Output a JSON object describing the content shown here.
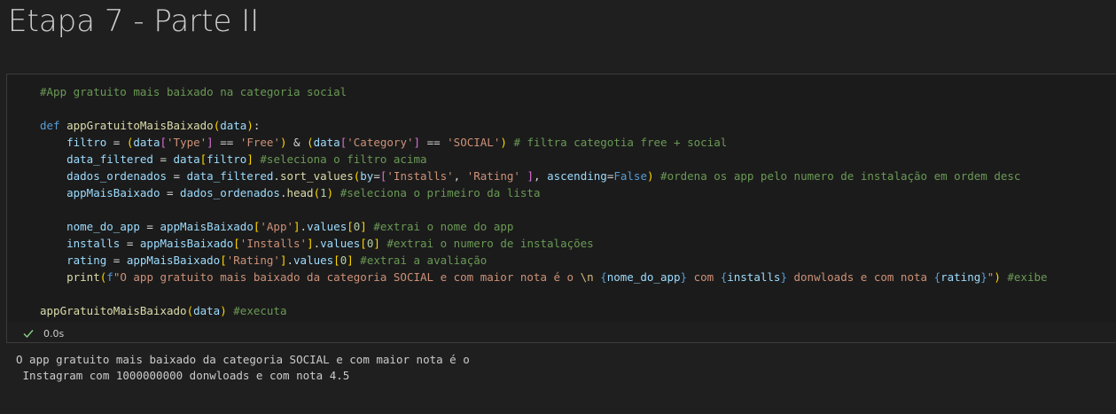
{
  "heading": "Etapa 7 - Parte II",
  "code_lines": [
    [
      [
        "t-comment",
        "#App gratuito mais baixado na categoria social"
      ]
    ],
    [],
    [
      [
        "t-keyword",
        "def "
      ],
      [
        "t-func",
        "appGratuitoMaisBaixado"
      ],
      [
        "t-bracket1",
        "("
      ],
      [
        "t-var",
        "data"
      ],
      [
        "t-bracket1",
        ")"
      ],
      [
        "t-plain",
        ":"
      ]
    ],
    [
      [
        "t-plain",
        "    "
      ],
      [
        "t-var",
        "filtro"
      ],
      [
        "t-plain",
        " = "
      ],
      [
        "t-bracket1",
        "("
      ],
      [
        "t-var",
        "data"
      ],
      [
        "t-bracket2",
        "["
      ],
      [
        "t-string",
        "'Type'"
      ],
      [
        "t-bracket2",
        "]"
      ],
      [
        "t-plain",
        " == "
      ],
      [
        "t-string",
        "'Free'"
      ],
      [
        "t-bracket1",
        ")"
      ],
      [
        "t-plain",
        " & "
      ],
      [
        "t-bracket1",
        "("
      ],
      [
        "t-var",
        "data"
      ],
      [
        "t-bracket2",
        "["
      ],
      [
        "t-string",
        "'Category'"
      ],
      [
        "t-bracket2",
        "]"
      ],
      [
        "t-plain",
        " == "
      ],
      [
        "t-string",
        "'SOCIAL'"
      ],
      [
        "t-bracket1",
        ")"
      ],
      [
        "t-plain",
        " "
      ],
      [
        "t-comment",
        "# filtra categotia free + social"
      ]
    ],
    [
      [
        "t-plain",
        "    "
      ],
      [
        "t-var",
        "data_filtered"
      ],
      [
        "t-plain",
        " = "
      ],
      [
        "t-var",
        "data"
      ],
      [
        "t-bracket1",
        "["
      ],
      [
        "t-var",
        "filtro"
      ],
      [
        "t-bracket1",
        "]"
      ],
      [
        "t-plain",
        " "
      ],
      [
        "t-comment",
        "#seleciona o filtro acima"
      ]
    ],
    [
      [
        "t-plain",
        "    "
      ],
      [
        "t-var",
        "dados_ordenados"
      ],
      [
        "t-plain",
        " = "
      ],
      [
        "t-var",
        "data_filtered"
      ],
      [
        "t-plain",
        "."
      ],
      [
        "t-func",
        "sort_values"
      ],
      [
        "t-bracket1",
        "("
      ],
      [
        "t-var",
        "by"
      ],
      [
        "t-plain",
        "="
      ],
      [
        "t-bracket2",
        "["
      ],
      [
        "t-string",
        "'Installs'"
      ],
      [
        "t-plain",
        ", "
      ],
      [
        "t-string",
        "'Rating'"
      ],
      [
        "t-plain",
        " "
      ],
      [
        "t-bracket2",
        "]"
      ],
      [
        "t-plain",
        ", "
      ],
      [
        "t-var",
        "ascending"
      ],
      [
        "t-plain",
        "="
      ],
      [
        "t-const",
        "False"
      ],
      [
        "t-bracket1",
        ")"
      ],
      [
        "t-plain",
        " "
      ],
      [
        "t-comment",
        "#ordena os app pelo numero de instalação em ordem desc"
      ]
    ],
    [
      [
        "t-plain",
        "    "
      ],
      [
        "t-var",
        "appMaisBaixado"
      ],
      [
        "t-plain",
        " = "
      ],
      [
        "t-var",
        "dados_ordenados"
      ],
      [
        "t-plain",
        "."
      ],
      [
        "t-func",
        "head"
      ],
      [
        "t-bracket1",
        "("
      ],
      [
        "t-number",
        "1"
      ],
      [
        "t-bracket1",
        ")"
      ],
      [
        "t-plain",
        " "
      ],
      [
        "t-comment",
        "#seleciona o primeiro da lista"
      ]
    ],
    [],
    [
      [
        "t-plain",
        "    "
      ],
      [
        "t-var",
        "nome_do_app"
      ],
      [
        "t-plain",
        " = "
      ],
      [
        "t-var",
        "appMaisBaixado"
      ],
      [
        "t-bracket1",
        "["
      ],
      [
        "t-string",
        "'App'"
      ],
      [
        "t-bracket1",
        "]"
      ],
      [
        "t-plain",
        "."
      ],
      [
        "t-var",
        "values"
      ],
      [
        "t-bracket1",
        "["
      ],
      [
        "t-number",
        "0"
      ],
      [
        "t-bracket1",
        "]"
      ],
      [
        "t-plain",
        " "
      ],
      [
        "t-comment",
        "#extrai o nome do app"
      ]
    ],
    [
      [
        "t-plain",
        "    "
      ],
      [
        "t-var",
        "installs"
      ],
      [
        "t-plain",
        " = "
      ],
      [
        "t-var",
        "appMaisBaixado"
      ],
      [
        "t-bracket1",
        "["
      ],
      [
        "t-string",
        "'Installs'"
      ],
      [
        "t-bracket1",
        "]"
      ],
      [
        "t-plain",
        "."
      ],
      [
        "t-var",
        "values"
      ],
      [
        "t-bracket1",
        "["
      ],
      [
        "t-number",
        "0"
      ],
      [
        "t-bracket1",
        "]"
      ],
      [
        "t-plain",
        " "
      ],
      [
        "t-comment",
        "#extrai o numero de instalações"
      ]
    ],
    [
      [
        "t-plain",
        "    "
      ],
      [
        "t-var",
        "rating"
      ],
      [
        "t-plain",
        " = "
      ],
      [
        "t-var",
        "appMaisBaixado"
      ],
      [
        "t-bracket1",
        "["
      ],
      [
        "t-string",
        "'Rating'"
      ],
      [
        "t-bracket1",
        "]"
      ],
      [
        "t-plain",
        "."
      ],
      [
        "t-var",
        "values"
      ],
      [
        "t-bracket1",
        "["
      ],
      [
        "t-number",
        "0"
      ],
      [
        "t-bracket1",
        "]"
      ],
      [
        "t-plain",
        " "
      ],
      [
        "t-comment",
        "#extrai a avaliação"
      ]
    ],
    [
      [
        "t-plain",
        "    "
      ],
      [
        "t-func",
        "print"
      ],
      [
        "t-bracket1",
        "("
      ],
      [
        "t-keyword",
        "f"
      ],
      [
        "t-string",
        "\"O app gratuito mais baixado da categoria SOCIAL e com maior nota é o "
      ],
      [
        "t-escape",
        "\\n"
      ],
      [
        "t-string",
        " "
      ],
      [
        "t-keyword",
        "{"
      ],
      [
        "t-var",
        "nome_do_app"
      ],
      [
        "t-keyword",
        "}"
      ],
      [
        "t-string",
        " com "
      ],
      [
        "t-keyword",
        "{"
      ],
      [
        "t-var",
        "installs"
      ],
      [
        "t-keyword",
        "}"
      ],
      [
        "t-string",
        " donwloads e com nota "
      ],
      [
        "t-keyword",
        "{"
      ],
      [
        "t-var",
        "rating"
      ],
      [
        "t-keyword",
        "}"
      ],
      [
        "t-string",
        "\""
      ],
      [
        "t-bracket1",
        ")"
      ],
      [
        "t-plain",
        " "
      ],
      [
        "t-comment",
        "#exibe"
      ]
    ],
    [],
    [
      [
        "t-func",
        "appGratuitoMaisBaixado"
      ],
      [
        "t-bracket1",
        "("
      ],
      [
        "t-var",
        "data"
      ],
      [
        "t-bracket1",
        ")"
      ],
      [
        "t-plain",
        " "
      ],
      [
        "t-comment",
        "#executa"
      ]
    ]
  ],
  "execution": {
    "status_icon": "check-icon",
    "duration": "0.0s",
    "success_color": "#89d185"
  },
  "output_text": "O app gratuito mais baixado da categoria SOCIAL e com maior nota é o\n Instagram com 1000000000 donwloads e com nota 4.5"
}
